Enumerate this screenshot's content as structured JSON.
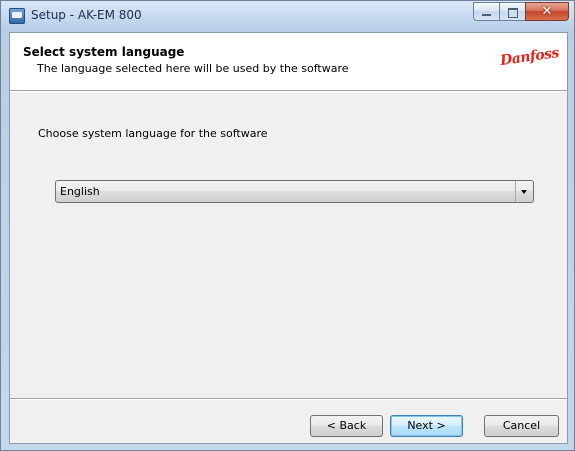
{
  "window": {
    "title": "Setup - AK-EM 800"
  },
  "header": {
    "title": "Select system language",
    "subtitle": "The language selected here will be used by the software",
    "logo_text": "Danfoss"
  },
  "main": {
    "prompt": "Choose system language for the software",
    "language_select": {
      "selected": "English"
    }
  },
  "footer": {
    "back_label": "< Back",
    "next_label": "Next >",
    "cancel_label": "Cancel"
  },
  "icons": {
    "app": "setup-app-icon",
    "minimize": "minimize-icon",
    "maximize": "maximize-icon",
    "close": "close-icon",
    "dropdown": "chevron-down-icon"
  },
  "colors": {
    "logo": "#e2231a",
    "close_button": "#c4452d",
    "default_button_border": "#3c7fb1"
  }
}
